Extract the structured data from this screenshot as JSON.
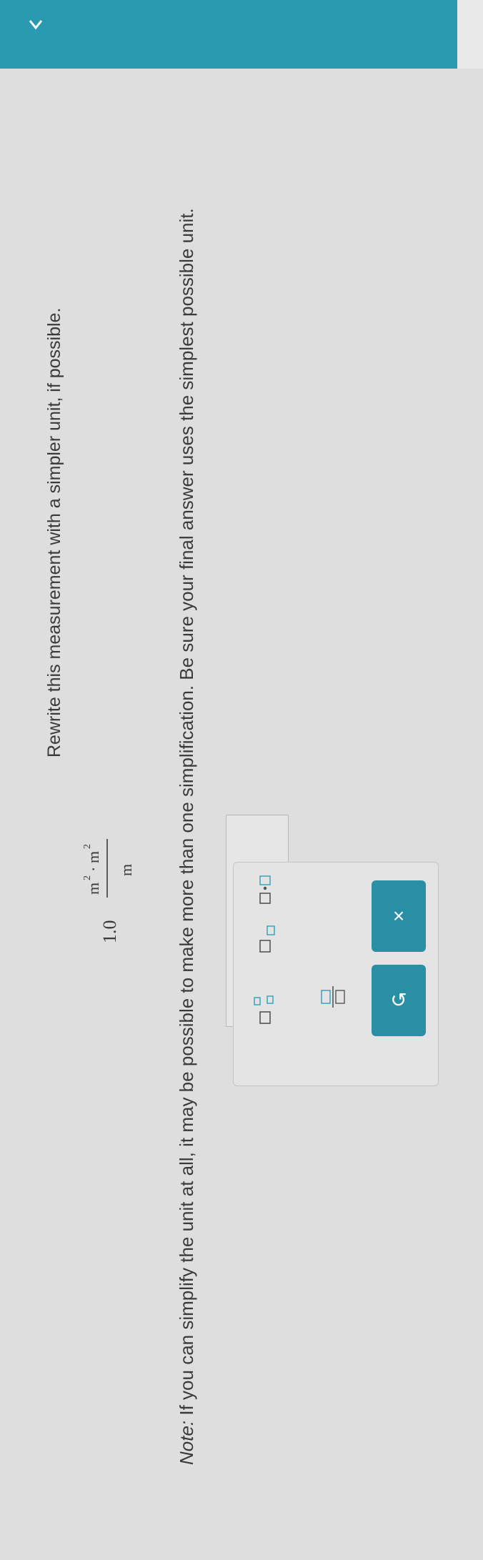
{
  "question": {
    "prompt": "Rewrite this measurement with a simpler unit, if possible.",
    "measurement": {
      "value": "1.0",
      "numerator": "m",
      "numerator_exp": "2",
      "dot": "·",
      "numerator2": "m",
      "numerator2_exp": "2",
      "denominator": "m"
    },
    "note_label": "Note:",
    "note_text": " If you can simplify the unit at all, it may be possible to make more than one simplification. Be sure your final answer uses the simplest possible unit."
  },
  "toolbar": {
    "buttons": [
      "subscript-superscript",
      "superscript",
      "multiply-dot",
      "fraction"
    ],
    "undo_label": "↺",
    "clear_label": "×"
  },
  "colors": {
    "accent": "#2a9ab0",
    "text": "#3a3a3a"
  },
  "icons": [
    "chevron-down-icon",
    "undo-icon",
    "close-icon"
  ]
}
